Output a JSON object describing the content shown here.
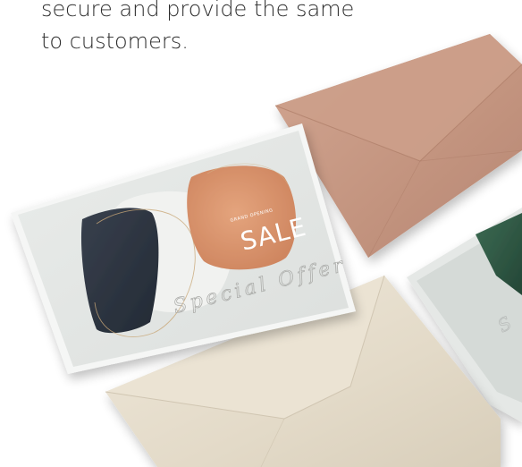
{
  "intro_text": {
    "line1": "secure and provide the same",
    "line2": "to customers."
  },
  "card": {
    "small_label": "GRAND OPENING",
    "sale_label": "SALE",
    "script_label": "Special Offer"
  },
  "colors": {
    "text": "#2d2d2d",
    "kraft_envelope": "#c89a84",
    "cream_envelope": "#e7dfcf",
    "card_background": "#e2e5e3",
    "navy_brush": "#2b3340",
    "terracotta_brush": "#d9926a",
    "green_card_accent": "#2f5a45"
  }
}
